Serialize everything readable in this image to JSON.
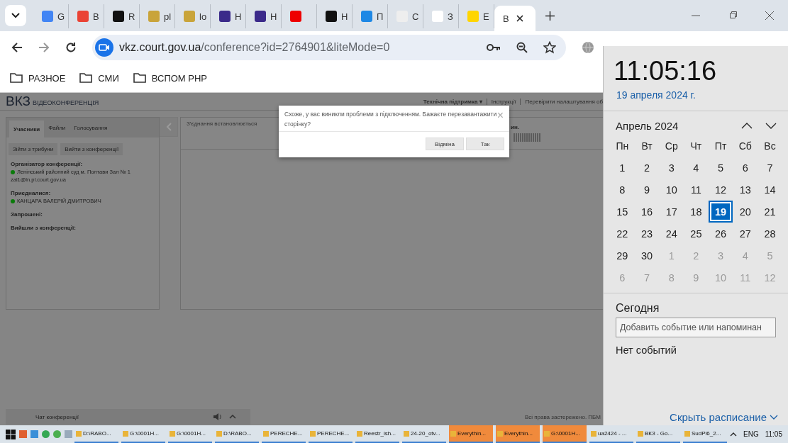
{
  "browser": {
    "tabs": [
      {
        "label": "G",
        "selected": false
      },
      {
        "label": "В",
        "selected": false
      },
      {
        "label": "R",
        "selected": false
      },
      {
        "label": "pl",
        "selected": false
      },
      {
        "label": "lo",
        "selected": false
      },
      {
        "label": "Н",
        "selected": false
      },
      {
        "label": "Н",
        "selected": false
      },
      {
        "selected": false
      },
      {
        "label": "Н",
        "selected": false
      },
      {
        "label": "П",
        "selected": false
      },
      {
        "label": "С",
        "selected": false
      },
      {
        "label": "З",
        "selected": false
      },
      {
        "label": "Е",
        "selected": false
      },
      {
        "label": "В",
        "selected": true
      }
    ],
    "url_host": "vkz.court.gov.ua",
    "url_path": "/conference?id=2764901&liteMode=0",
    "bookmarks": [
      "РАЗНОЕ",
      "СМИ",
      "ВСПОМ РНР"
    ]
  },
  "page": {
    "logo": "ВКЗ",
    "logo_sub": "ВІДЕОКОНФЕРЕНЦІЯ",
    "header_links": [
      {
        "label": "Технічна підтримка ▾",
        "bold": true
      },
      {
        "label": "Інструкції",
        "bold": false
      },
      {
        "label": "Перевірити налаштування об",
        "bold": false
      }
    ],
    "panel_tabs": [
      {
        "label": "Учасники",
        "selected": true
      },
      {
        "label": "Файли",
        "selected": false
      },
      {
        "label": "Голосування",
        "selected": false
      }
    ],
    "panel_buttons": [
      "Зійти з трибуни",
      "Вийти з конференції"
    ],
    "sections": [
      {
        "title": "Організатор конференції:",
        "people": [
          {
            "name": "Ленінський районний суд м. Полтави Зал № 1",
            "email": "zal1@ln.pl.court.gov.ua",
            "color": "#0a7a0a"
          }
        ]
      },
      {
        "title": "Приєдналися:",
        "people": [
          {
            "name": "КАНЦАРА ВАЛЕРІЙ ДМИТРОВИЧ",
            "color": "#0a7a0a"
          }
        ]
      },
      {
        "title": "Запрошені:"
      },
      {
        "title": "Вийшли з конференції:"
      }
    ],
    "status": "З'єднання встановлюється",
    "status_2": "ин.",
    "chat_label": "Чат конференції",
    "copyright": "Всі права застережено. ПБМ"
  },
  "dialog": {
    "message": "Схоже, у вас виникли проблеми з підключенням. Бажаєте перезавантажити сторінку?",
    "close": "×",
    "buttons": [
      "Відміна",
      "Так"
    ]
  },
  "calendar": {
    "time": "11:05:16",
    "date": "19 апреля 2024 г.",
    "month": "Апрель 2024",
    "weekdays": [
      "Пн",
      "Вт",
      "Ср",
      "Чт",
      "Пт",
      "Сб",
      "Вс"
    ],
    "days": [
      {
        "d": "1",
        "other": false,
        "selected": false
      },
      {
        "d": "2",
        "other": false,
        "selected": false
      },
      {
        "d": "3",
        "other": false,
        "selected": false
      },
      {
        "d": "4",
        "other": false,
        "selected": false
      },
      {
        "d": "5",
        "other": false,
        "selected": false
      },
      {
        "d": "6",
        "other": false,
        "selected": false
      },
      {
        "d": "7",
        "other": false,
        "selected": false
      },
      {
        "d": "8",
        "other": false,
        "selected": false
      },
      {
        "d": "9",
        "other": false,
        "selected": false
      },
      {
        "d": "10",
        "other": false,
        "selected": false
      },
      {
        "d": "11",
        "other": false,
        "selected": false
      },
      {
        "d": "12",
        "other": false,
        "selected": false
      },
      {
        "d": "13",
        "other": false,
        "selected": false
      },
      {
        "d": "14",
        "other": false,
        "selected": false
      },
      {
        "d": "15",
        "other": false,
        "selected": false
      },
      {
        "d": "16",
        "other": false,
        "selected": false
      },
      {
        "d": "17",
        "other": false,
        "selected": false
      },
      {
        "d": "18",
        "other": false,
        "selected": false
      },
      {
        "d": "19",
        "other": false,
        "selected": true
      },
      {
        "d": "20",
        "other": false,
        "selected": false
      },
      {
        "d": "21",
        "other": false,
        "selected": false
      },
      {
        "d": "22",
        "other": false,
        "selected": false
      },
      {
        "d": "23",
        "other": false,
        "selected": false
      },
      {
        "d": "24",
        "other": false,
        "selected": false
      },
      {
        "d": "25",
        "other": false,
        "selected": false
      },
      {
        "d": "26",
        "other": false,
        "selected": false
      },
      {
        "d": "27",
        "other": false,
        "selected": false
      },
      {
        "d": "28",
        "other": false,
        "selected": false
      },
      {
        "d": "29",
        "other": false,
        "selected": false
      },
      {
        "d": "30",
        "other": false,
        "selected": false
      },
      {
        "d": "1",
        "other": true,
        "selected": false
      },
      {
        "d": "2",
        "other": true,
        "selected": false
      },
      {
        "d": "3",
        "other": true,
        "selected": false
      },
      {
        "d": "4",
        "other": true,
        "selected": false
      },
      {
        "d": "5",
        "other": true,
        "selected": false
      },
      {
        "d": "6",
        "other": true,
        "selected": false
      },
      {
        "d": "7",
        "other": true,
        "selected": false
      },
      {
        "d": "8",
        "other": true,
        "selected": false
      },
      {
        "d": "9",
        "other": true,
        "selected": false
      },
      {
        "d": "10",
        "other": true,
        "selected": false
      },
      {
        "d": "11",
        "other": true,
        "selected": false
      },
      {
        "d": "12",
        "other": true,
        "selected": false
      }
    ],
    "today_label": "Сегодня",
    "event_placeholder": "Добавить событие или напоминан",
    "no_events": "Нет событий",
    "hide": "Скрыть расписание"
  },
  "taskbar": {
    "items": [
      {
        "label": "D:\\RABO...",
        "selected": false
      },
      {
        "label": "G:\\0001H...",
        "selected": false
      },
      {
        "label": "G:\\0001H...",
        "selected": false
      },
      {
        "label": "D:\\RABO...",
        "selected": false
      },
      {
        "label": "PERECHE...",
        "selected": false
      },
      {
        "label": "PERECHE...",
        "selected": false
      },
      {
        "label": "Reestr_ish...",
        "selected": false
      },
      {
        "label": "24-20_otv...",
        "selected": false
      },
      {
        "label": "Everythin...",
        "selected": true
      },
      {
        "label": "Everythin...",
        "selected": true
      },
      {
        "label": "G:\\0001H...",
        "selected": true
      },
      {
        "label": "ua2424 - ...",
        "selected": false
      },
      {
        "label": "ВКЗ - Go...",
        "selected": false
      },
      {
        "label": "SudPl6_2...",
        "selected": false
      }
    ],
    "lang": "ENG",
    "clock": "11:05"
  }
}
